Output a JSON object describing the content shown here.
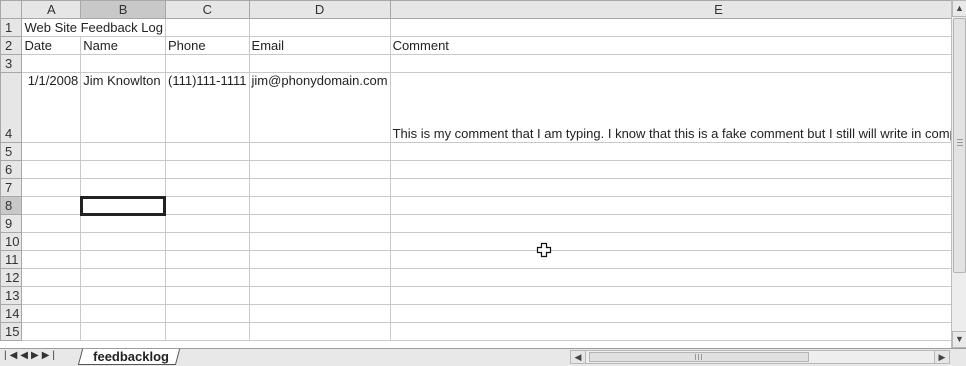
{
  "columns": [
    "A",
    "B",
    "C",
    "D",
    "E"
  ],
  "row_numbers": [
    "1",
    "2",
    "3",
    "4",
    "5",
    "6",
    "7",
    "8",
    "9",
    "10",
    "11",
    "12",
    "13",
    "14",
    "15"
  ],
  "cells": {
    "a1": "Web Site Feedback Log",
    "a2": "Date",
    "b2": "Name",
    "c2": "Phone",
    "d2": "Email",
    "e2": "Comment",
    "a4": "1/1/2008",
    "b4": "Jim Knowlton",
    "c4": "(111)111-1111",
    "d4": "jim@phonydomain.com",
    "e4": "This is my comment that I am typing.  I know that this is a fake comment but I still will write in complete sentences."
  },
  "active_cell": "B8",
  "sheet_tab": "feedbacklog",
  "nav_buttons": [
    "first-sheet",
    "prev-sheet",
    "next-sheet",
    "last-sheet"
  ],
  "icons": {
    "scroll_up": "up-arrow-icon",
    "scroll_down": "down-arrow-icon",
    "scroll_left": "left-arrow-icon",
    "scroll_right": "right-arrow-icon",
    "cursor": "cell-select-cross-cursor-icon"
  }
}
